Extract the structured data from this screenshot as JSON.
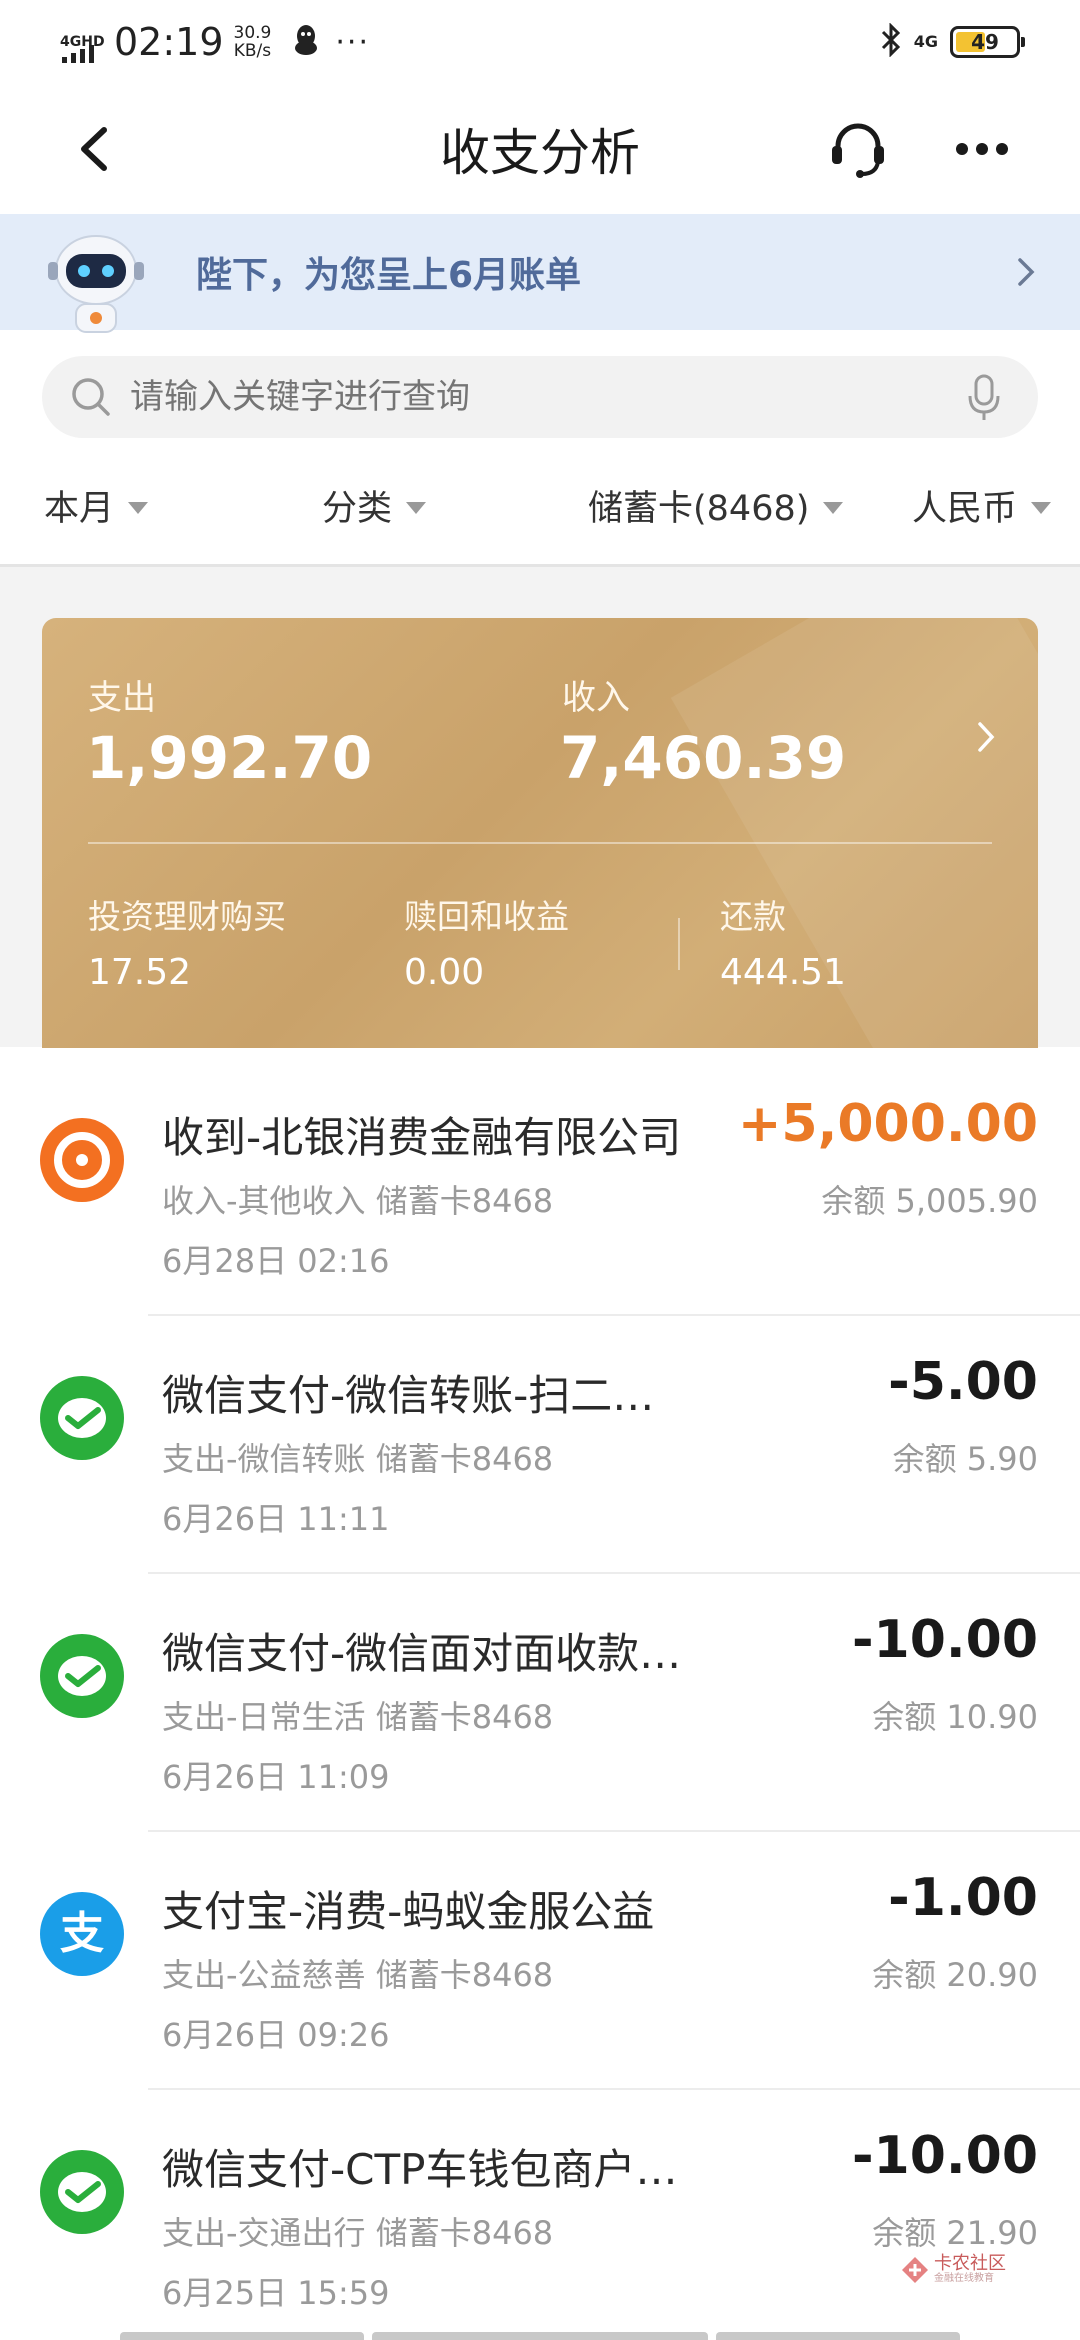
{
  "status_bar": {
    "network": "4GHD",
    "time": "02:19",
    "speed_value": "30.9",
    "speed_unit": "KB/s",
    "dots": "···",
    "mobile": "4G",
    "battery": "49"
  },
  "nav": {
    "title": "收支分析"
  },
  "banner": {
    "text": "陛下，为您呈上6月账单"
  },
  "search": {
    "placeholder": "请输入关键字进行查询"
  },
  "filters": {
    "period": "本月",
    "category": "分类",
    "account": "储蓄卡(8468)",
    "currency": "人民币"
  },
  "summary": {
    "expense_label": "支出",
    "expense_value": "1,992.70",
    "income_label": "收入",
    "income_value": "7,460.39",
    "invest_label": "投资理财购买",
    "invest_value": "17.52",
    "redeem_label": "赎回和收益",
    "redeem_value": "0.00",
    "repay_label": "还款",
    "repay_value": "444.51"
  },
  "transactions": [
    {
      "title": "收到-北银消费金融有限公司",
      "sub": "收入-其他收入 储蓄卡8468",
      "date": "6月28日 02:16",
      "amount": "+5,000.00",
      "balance": "余额 5,005.90",
      "icon": "bank-transfer-icon",
      "color": "#f37021"
    },
    {
      "title": "微信支付-微信转账-扫二…",
      "sub": "支出-微信转账 储蓄卡8468",
      "date": "6月26日 11:11",
      "amount": "-5.00",
      "balance": "余额 5.90",
      "icon": "wechat-pay-icon",
      "color": "#2aae3c"
    },
    {
      "title": "微信支付-微信面对面收款…",
      "sub": "支出-日常生活 储蓄卡8468",
      "date": "6月26日 11:09",
      "amount": "-10.00",
      "balance": "余额 10.90",
      "icon": "wechat-pay-icon",
      "color": "#2aae3c"
    },
    {
      "title": "支付宝-消费-蚂蚁金服公益",
      "sub": "支出-公益慈善 储蓄卡8468",
      "date": "6月26日 09:26",
      "amount": "-1.00",
      "balance": "余额 20.90",
      "icon": "alipay-icon",
      "color": "#1a9ee8"
    },
    {
      "title": "微信支付-CTP车钱包商户…",
      "sub": "支出-交通出行 储蓄卡8468",
      "date": "6月25日 15:59",
      "amount": "-10.00",
      "balance": "余额 21.90",
      "icon": "wechat-pay-icon",
      "color": "#2aae3c"
    }
  ],
  "watermark": {
    "text": "卡农社区",
    "sub": "金融在线教育"
  }
}
